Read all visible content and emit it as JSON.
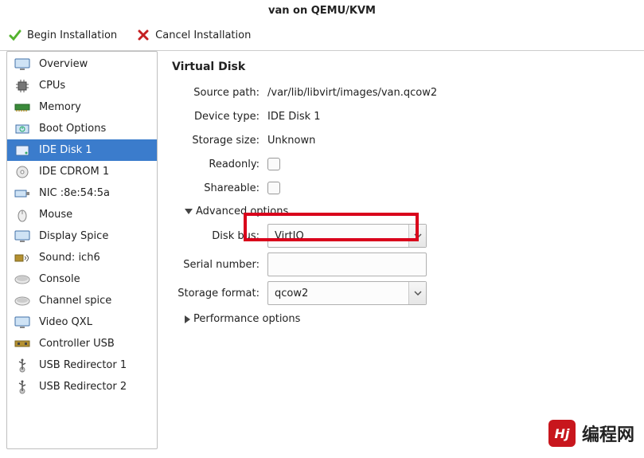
{
  "window": {
    "title": "van on QEMU/KVM"
  },
  "toolbar": {
    "begin_label": "Begin Installation",
    "cancel_label": "Cancel Installation"
  },
  "sidebar": {
    "items": [
      {
        "label": "Overview",
        "icon": "monitor"
      },
      {
        "label": "CPUs",
        "icon": "cpu"
      },
      {
        "label": "Memory",
        "icon": "memory"
      },
      {
        "label": "Boot Options",
        "icon": "boot"
      },
      {
        "label": "IDE Disk 1",
        "icon": "disk",
        "selected": true
      },
      {
        "label": "IDE CDROM 1",
        "icon": "cdrom"
      },
      {
        "label": "NIC :8e:54:5a",
        "icon": "nic"
      },
      {
        "label": "Mouse",
        "icon": "mouse"
      },
      {
        "label": "Display Spice",
        "icon": "monitor"
      },
      {
        "label": "Sound: ich6",
        "icon": "sound"
      },
      {
        "label": "Console",
        "icon": "console"
      },
      {
        "label": "Channel spice",
        "icon": "console"
      },
      {
        "label": "Video QXL",
        "icon": "monitor"
      },
      {
        "label": "Controller USB",
        "icon": "usb-ctrl"
      },
      {
        "label": "USB Redirector 1",
        "icon": "usb"
      },
      {
        "label": "USB Redirector 2",
        "icon": "usb"
      }
    ]
  },
  "panel": {
    "heading": "Virtual Disk",
    "source_path_label": "Source path:",
    "source_path_value": "/var/lib/libvirt/images/van.qcow2",
    "device_type_label": "Device type:",
    "device_type_value": "IDE Disk 1",
    "storage_size_label": "Storage size:",
    "storage_size_value": "Unknown",
    "readonly_label": "Readonly:",
    "shareable_label": "Shareable:",
    "advanced_label": "Advanced options",
    "disk_bus_label": "Disk bus:",
    "disk_bus_value": "VirtIO",
    "serial_label": "Serial number:",
    "serial_value": "",
    "storage_format_label": "Storage format:",
    "storage_format_value": "qcow2",
    "perf_label": "Performance options"
  },
  "watermark": {
    "logo": "Hj",
    "text": "编程网"
  }
}
